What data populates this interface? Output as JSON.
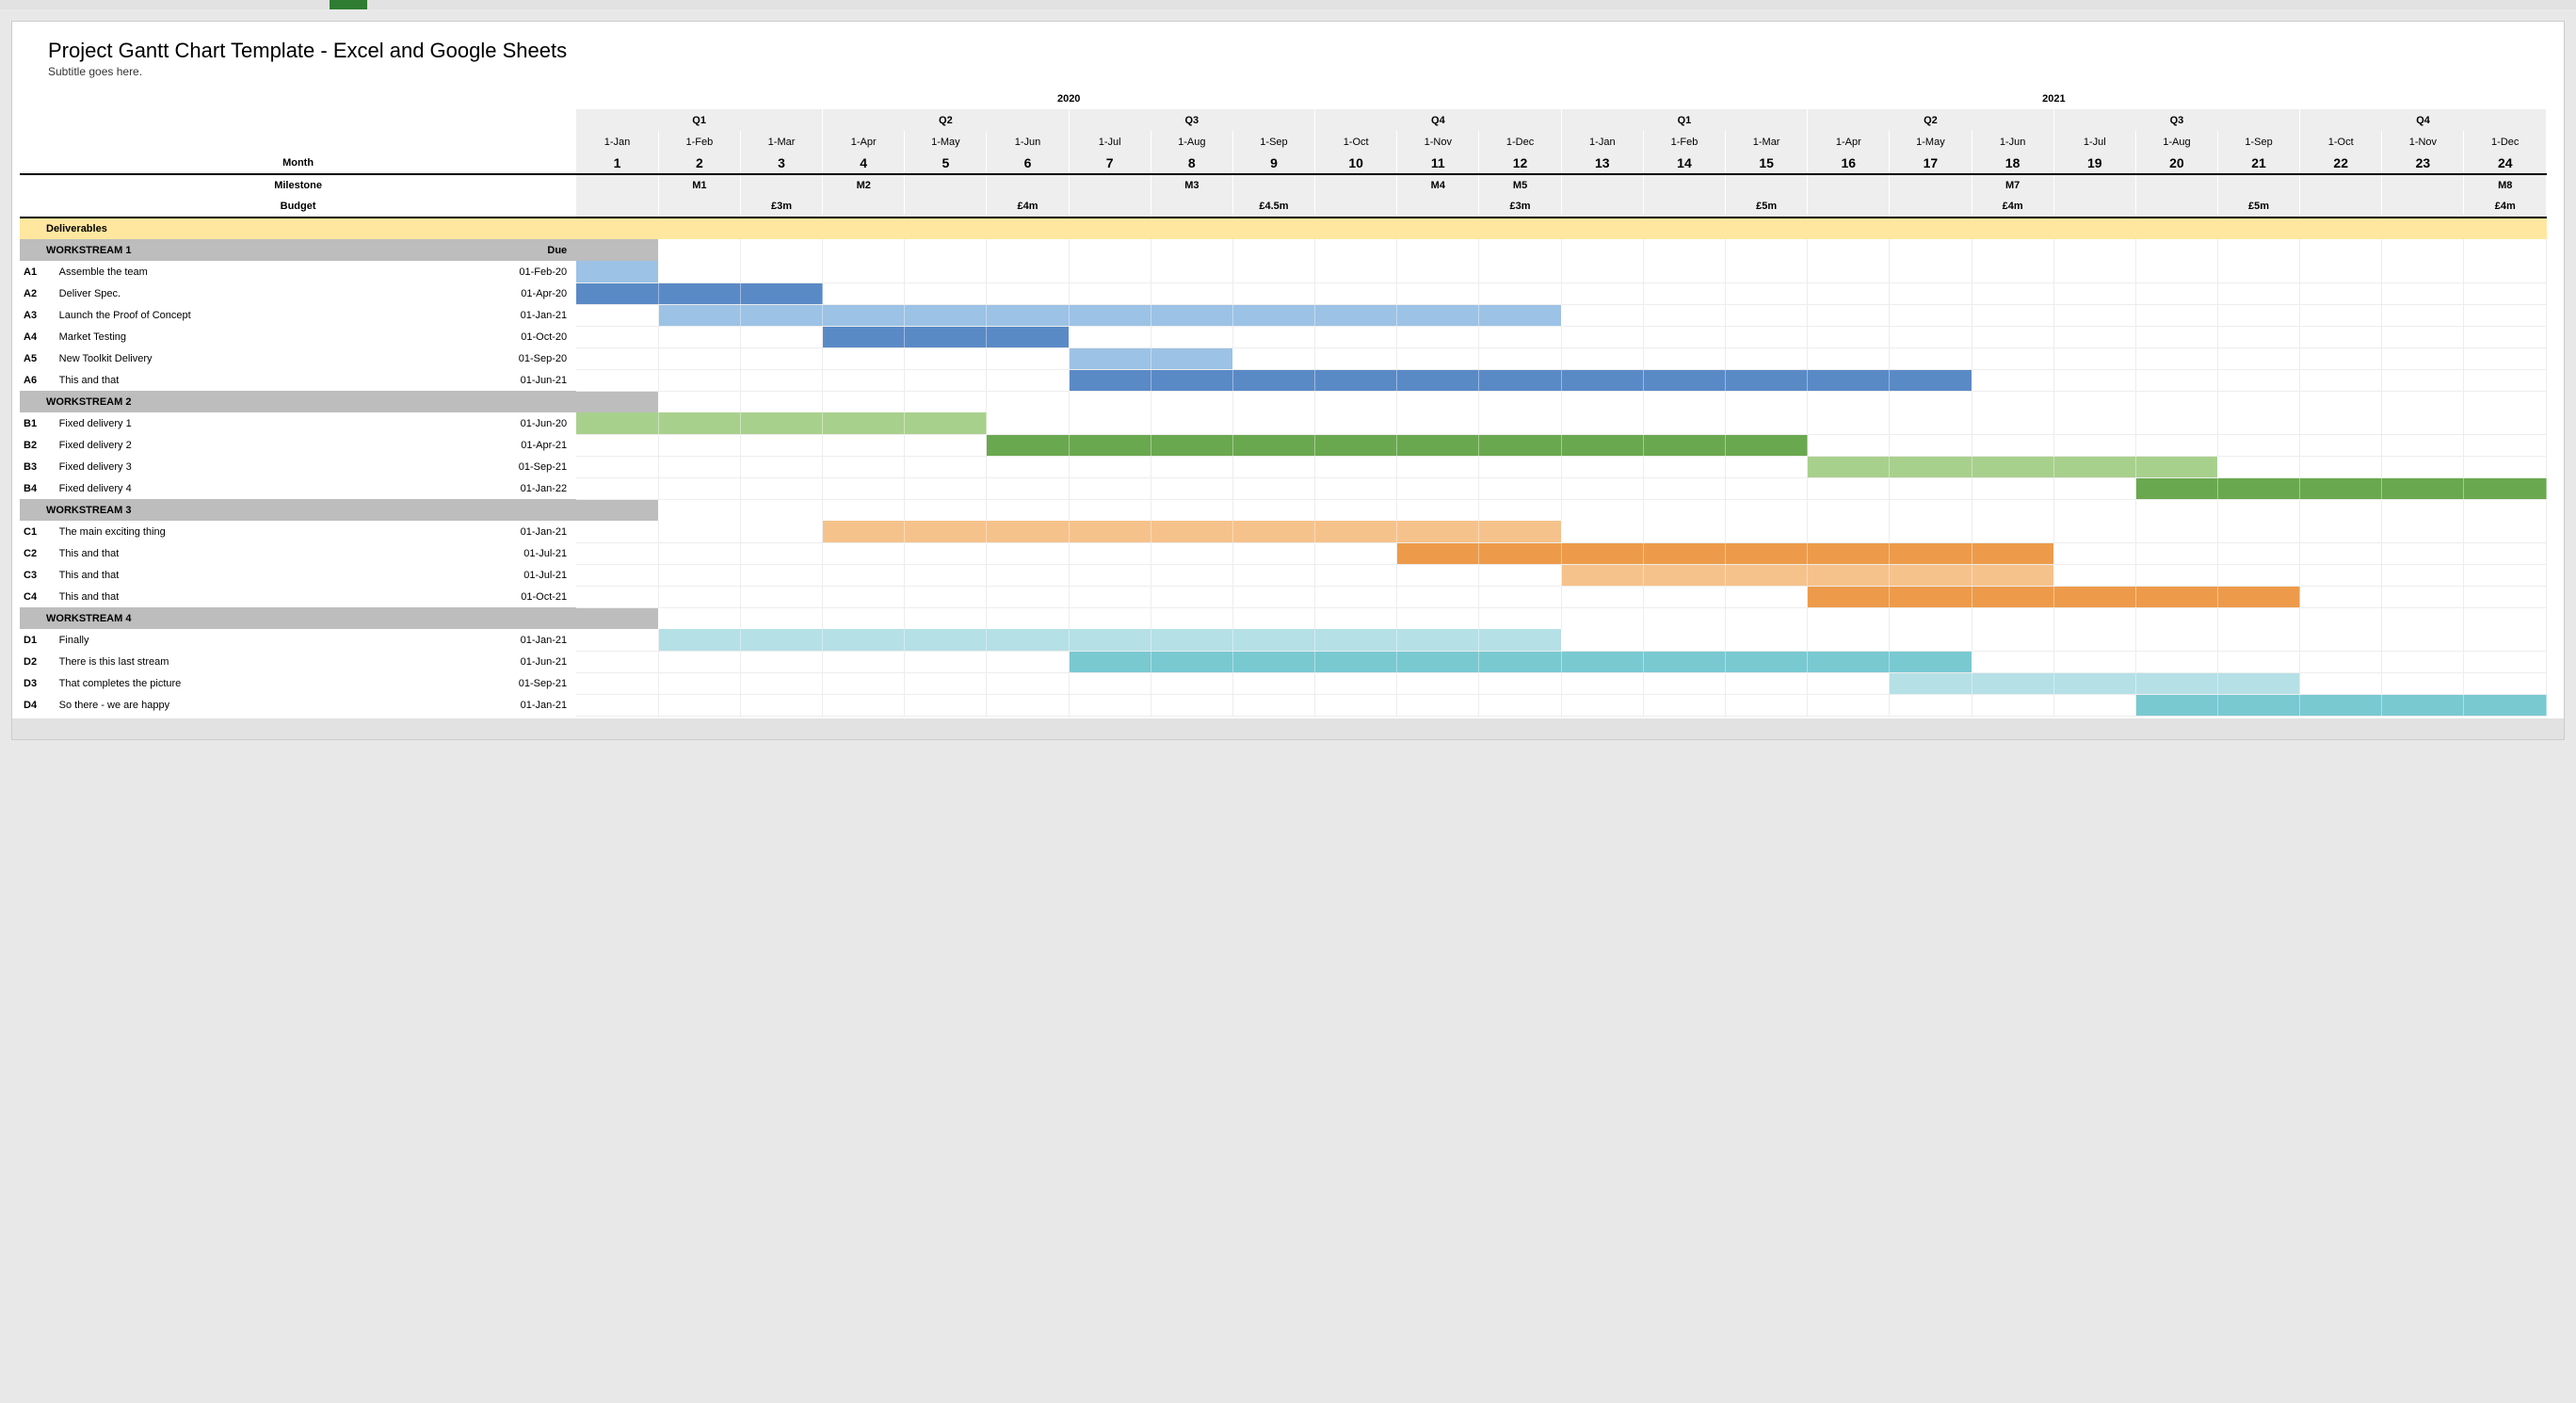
{
  "title": "Project Gantt Chart Template - Excel and Google Sheets",
  "subtitle": "Subtitle goes here.",
  "header_labels": {
    "month": "Month",
    "milestone": "Milestone",
    "budget": "Budget",
    "deliverables": "Deliverables",
    "due": "Due"
  },
  "years": [
    "2020",
    "2021"
  ],
  "quarters": [
    "Q1",
    "Q2",
    "Q3",
    "Q4",
    "Q1",
    "Q2",
    "Q3",
    "Q4"
  ],
  "months": [
    {
      "date": "1-Jan",
      "num": "1"
    },
    {
      "date": "1-Feb",
      "num": "2"
    },
    {
      "date": "1-Mar",
      "num": "3"
    },
    {
      "date": "1-Apr",
      "num": "4"
    },
    {
      "date": "1-May",
      "num": "5"
    },
    {
      "date": "1-Jun",
      "num": "6"
    },
    {
      "date": "1-Jul",
      "num": "7"
    },
    {
      "date": "1-Aug",
      "num": "8"
    },
    {
      "date": "1-Sep",
      "num": "9"
    },
    {
      "date": "1-Oct",
      "num": "10"
    },
    {
      "date": "1-Nov",
      "num": "11"
    },
    {
      "date": "1-Dec",
      "num": "12"
    },
    {
      "date": "1-Jan",
      "num": "13"
    },
    {
      "date": "1-Feb",
      "num": "14"
    },
    {
      "date": "1-Mar",
      "num": "15"
    },
    {
      "date": "1-Apr",
      "num": "16"
    },
    {
      "date": "1-May",
      "num": "17"
    },
    {
      "date": "1-Jun",
      "num": "18"
    },
    {
      "date": "1-Jul",
      "num": "19"
    },
    {
      "date": "1-Aug",
      "num": "20"
    },
    {
      "date": "1-Sep",
      "num": "21"
    },
    {
      "date": "1-Oct",
      "num": "22"
    },
    {
      "date": "1-Nov",
      "num": "23"
    },
    {
      "date": "1-Dec",
      "num": "24"
    }
  ],
  "milestones": {
    "2": "M1",
    "4": "M2",
    "8": "M3",
    "11": "M4",
    "12": "M5",
    "18": "M7",
    "24": "M8"
  },
  "budgets": {
    "3": "£3m",
    "6": "£4m",
    "9": "£4.5m",
    "12": "£3m",
    "15": "£5m",
    "18": "£4m",
    "21": "£5m",
    "24": "£4m"
  },
  "workstreams": [
    {
      "name": "WORKSTREAM 1",
      "light": "#9cc2e5",
      "dark": "#5a8ac6",
      "tasks": [
        {
          "id": "A1",
          "name": "Assemble the team",
          "due": "01-Feb-20",
          "start": 1,
          "end": 1,
          "shade": "light"
        },
        {
          "id": "A2",
          "name": "Deliver Spec.",
          "due": "01-Apr-20",
          "start": 1,
          "end": 3,
          "shade": "dark"
        },
        {
          "id": "A3",
          "name": "Launch the Proof of Concept",
          "due": "01-Jan-21",
          "start": 2,
          "end": 12,
          "shade": "light"
        },
        {
          "id": "A4",
          "name": "Market Testing",
          "due": "01-Oct-20",
          "start": 4,
          "end": 6,
          "shade": "dark"
        },
        {
          "id": "A5",
          "name": "New Toolkit Delivery",
          "due": "01-Sep-20",
          "start": 7,
          "end": 8,
          "shade": "light"
        },
        {
          "id": "A6",
          "name": "This and that",
          "due": "01-Jun-21",
          "start": 7,
          "end": 17,
          "shade": "dark"
        }
      ]
    },
    {
      "name": "WORKSTREAM 2",
      "light": "#a8d08d",
      "dark": "#6aa84f",
      "tasks": [
        {
          "id": "B1",
          "name": "Fixed delivery 1",
          "due": "01-Jun-20",
          "start": 1,
          "end": 5,
          "shade": "light"
        },
        {
          "id": "B2",
          "name": "Fixed delivery 2",
          "due": "01-Apr-21",
          "start": 6,
          "end": 15,
          "shade": "dark"
        },
        {
          "id": "B3",
          "name": "Fixed delivery 3",
          "due": "01-Sep-21",
          "start": 16,
          "end": 20,
          "shade": "light"
        },
        {
          "id": "B4",
          "name": "Fixed delivery 4",
          "due": "01-Jan-22",
          "start": 20,
          "end": 24,
          "shade": "dark"
        }
      ]
    },
    {
      "name": "WORKSTREAM 3",
      "light": "#f6c28b",
      "dark": "#ed9b4a",
      "tasks": [
        {
          "id": "C1",
          "name": "The main exciting thing",
          "due": "01-Jan-21",
          "start": 4,
          "end": 12,
          "shade": "light"
        },
        {
          "id": "C2",
          "name": "This and that",
          "due": "01-Jul-21",
          "start": 11,
          "end": 18,
          "shade": "dark"
        },
        {
          "id": "C3",
          "name": "This and that",
          "due": "01-Jul-21",
          "start": 13,
          "end": 18,
          "shade": "light"
        },
        {
          "id": "C4",
          "name": "This and that",
          "due": "01-Oct-21",
          "start": 16,
          "end": 21,
          "shade": "dark"
        }
      ]
    },
    {
      "name": "WORKSTREAM 4",
      "light": "#b5e0e6",
      "dark": "#79c9d1",
      "tasks": [
        {
          "id": "D1",
          "name": "Finally",
          "due": "01-Jan-21",
          "start": 2,
          "end": 12,
          "shade": "light"
        },
        {
          "id": "D2",
          "name": "There is this last stream",
          "due": "01-Jun-21",
          "start": 7,
          "end": 17,
          "shade": "dark"
        },
        {
          "id": "D3",
          "name": "That completes the picture",
          "due": "01-Sep-21",
          "start": 17,
          "end": 21,
          "shade": "light"
        },
        {
          "id": "D4",
          "name": "So there - we are happy",
          "due": "01-Jan-21",
          "start": 20,
          "end": 24,
          "shade": "dark"
        }
      ]
    }
  ],
  "chart_data": {
    "type": "bar",
    "title": "Project Gantt Chart Template - Excel and Google Sheets",
    "xlabel": "Month",
    "ylabel": "",
    "x_range": [
      1,
      24
    ],
    "x_ticks_dates": [
      "1-Jan-2020",
      "1-Feb-2020",
      "1-Mar-2020",
      "1-Apr-2020",
      "1-May-2020",
      "1-Jun-2020",
      "1-Jul-2020",
      "1-Aug-2020",
      "1-Sep-2020",
      "1-Oct-2020",
      "1-Nov-2020",
      "1-Dec-2020",
      "1-Jan-2021",
      "1-Feb-2021",
      "1-Mar-2021",
      "1-Apr-2021",
      "1-May-2021",
      "1-Jun-2021",
      "1-Jul-2021",
      "1-Aug-2021",
      "1-Sep-2021",
      "1-Oct-2021",
      "1-Nov-2021",
      "1-Dec-2021"
    ],
    "milestones": [
      {
        "month": 2,
        "label": "M1"
      },
      {
        "month": 4,
        "label": "M2"
      },
      {
        "month": 8,
        "label": "M3"
      },
      {
        "month": 11,
        "label": "M4"
      },
      {
        "month": 12,
        "label": "M5"
      },
      {
        "month": 18,
        "label": "M7"
      },
      {
        "month": 24,
        "label": "M8"
      }
    ],
    "quarterly_budget": [
      {
        "quarter": "2020 Q1",
        "value": "£3m"
      },
      {
        "quarter": "2020 Q2",
        "value": "£4m"
      },
      {
        "quarter": "2020 Q3",
        "value": "£4.5m"
      },
      {
        "quarter": "2020 Q4",
        "value": "£3m"
      },
      {
        "quarter": "2021 Q1",
        "value": "£5m"
      },
      {
        "quarter": "2021 Q2",
        "value": "£4m"
      },
      {
        "quarter": "2021 Q3",
        "value": "£5m"
      },
      {
        "quarter": "2021 Q4",
        "value": "£4m"
      }
    ],
    "series": [
      {
        "group": "WORKSTREAM 1",
        "id": "A1",
        "name": "Assemble the team",
        "due": "01-Feb-20",
        "start_month": 1,
        "end_month": 1
      },
      {
        "group": "WORKSTREAM 1",
        "id": "A2",
        "name": "Deliver Spec.",
        "due": "01-Apr-20",
        "start_month": 1,
        "end_month": 3
      },
      {
        "group": "WORKSTREAM 1",
        "id": "A3",
        "name": "Launch the Proof of Concept",
        "due": "01-Jan-21",
        "start_month": 2,
        "end_month": 12
      },
      {
        "group": "WORKSTREAM 1",
        "id": "A4",
        "name": "Market Testing",
        "due": "01-Oct-20",
        "start_month": 4,
        "end_month": 6
      },
      {
        "group": "WORKSTREAM 1",
        "id": "A5",
        "name": "New Toolkit Delivery",
        "due": "01-Sep-20",
        "start_month": 7,
        "end_month": 8
      },
      {
        "group": "WORKSTREAM 1",
        "id": "A6",
        "name": "This and that",
        "due": "01-Jun-21",
        "start_month": 7,
        "end_month": 17
      },
      {
        "group": "WORKSTREAM 2",
        "id": "B1",
        "name": "Fixed delivery 1",
        "due": "01-Jun-20",
        "start_month": 1,
        "end_month": 5
      },
      {
        "group": "WORKSTREAM 2",
        "id": "B2",
        "name": "Fixed delivery 2",
        "due": "01-Apr-21",
        "start_month": 6,
        "end_month": 15
      },
      {
        "group": "WORKSTREAM 2",
        "id": "B3",
        "name": "Fixed delivery 3",
        "due": "01-Sep-21",
        "start_month": 16,
        "end_month": 20
      },
      {
        "group": "WORKSTREAM 2",
        "id": "B4",
        "name": "Fixed delivery 4",
        "due": "01-Jan-22",
        "start_month": 20,
        "end_month": 24
      },
      {
        "group": "WORKSTREAM 3",
        "id": "C1",
        "name": "The main exciting thing",
        "due": "01-Jan-21",
        "start_month": 4,
        "end_month": 12
      },
      {
        "group": "WORKSTREAM 3",
        "id": "C2",
        "name": "This and that",
        "due": "01-Jul-21",
        "start_month": 11,
        "end_month": 18
      },
      {
        "group": "WORKSTREAM 3",
        "id": "C3",
        "name": "This and that",
        "due": "01-Jul-21",
        "start_month": 13,
        "end_month": 18
      },
      {
        "group": "WORKSTREAM 3",
        "id": "C4",
        "name": "This and that",
        "due": "01-Oct-21",
        "start_month": 16,
        "end_month": 21
      },
      {
        "group": "WORKSTREAM 4",
        "id": "D1",
        "name": "Finally",
        "due": "01-Jan-21",
        "start_month": 2,
        "end_month": 12
      },
      {
        "group": "WORKSTREAM 4",
        "id": "D2",
        "name": "There is this last stream",
        "due": "01-Jun-21",
        "start_month": 7,
        "end_month": 17
      },
      {
        "group": "WORKSTREAM 4",
        "id": "D3",
        "name": "That completes the picture",
        "due": "01-Sep-21",
        "start_month": 17,
        "end_month": 21
      },
      {
        "group": "WORKSTREAM 4",
        "id": "D4",
        "name": "So there - we are happy",
        "due": "01-Jan-21",
        "start_month": 20,
        "end_month": 24
      }
    ]
  }
}
